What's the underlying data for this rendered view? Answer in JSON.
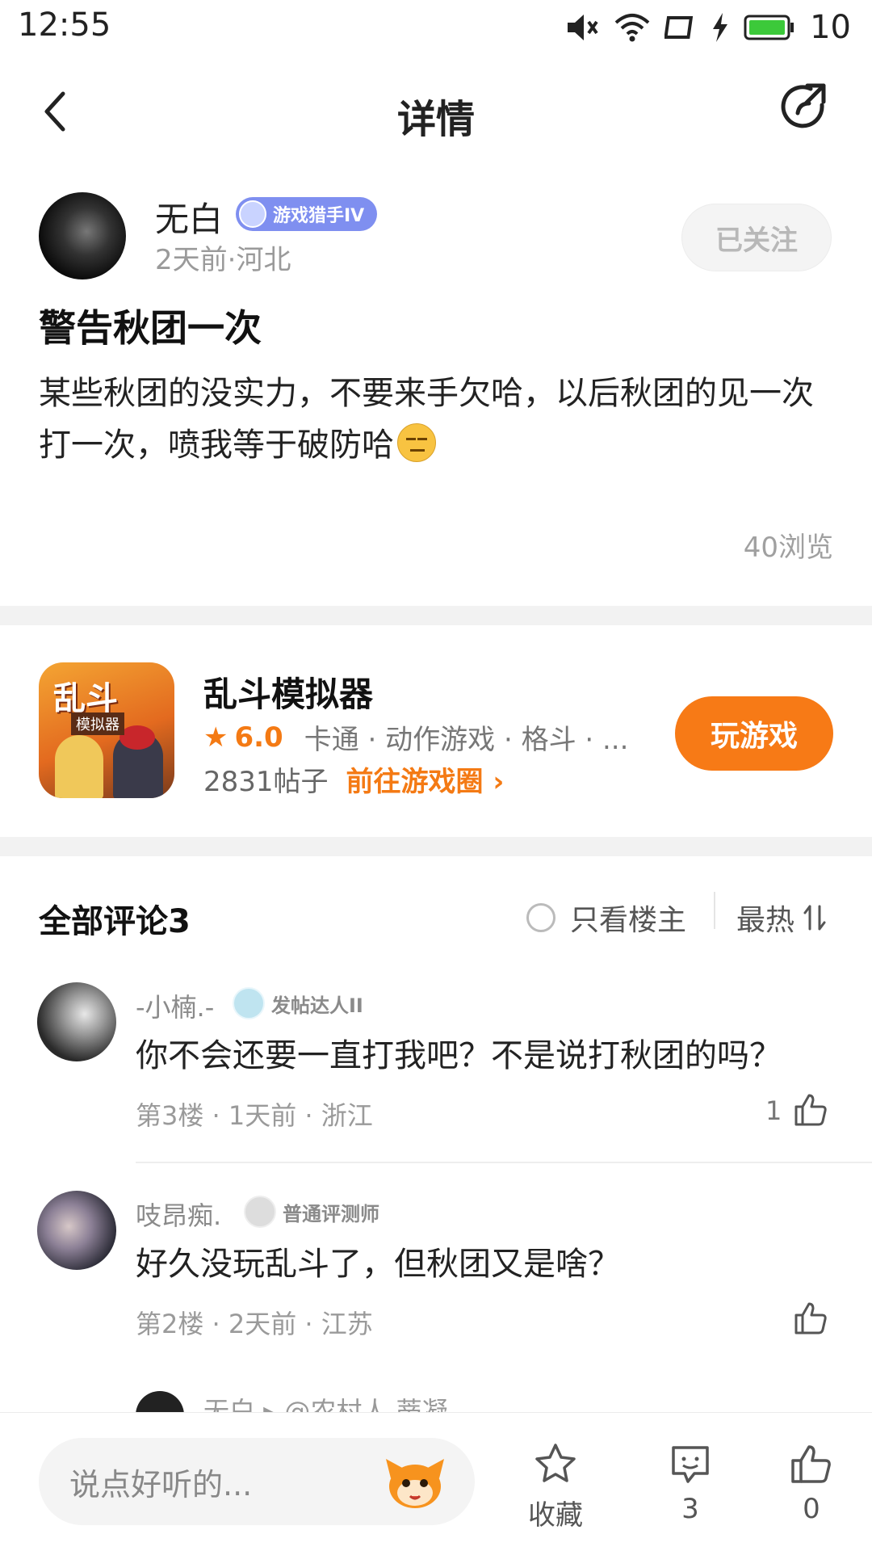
{
  "status_bar": {
    "time": "12:55",
    "battery": "10"
  },
  "header": {
    "title": "详情"
  },
  "author": {
    "name": "无白",
    "badge": "游戏猎手IV",
    "meta": "2天前·河北",
    "follow_label": "已关注"
  },
  "post": {
    "title": "警告秋团一次",
    "body": "某些秋团的没实力，不要来手欠哈，以后秋团的见一次打一次，喷我等于破防哈",
    "views": "40浏览"
  },
  "game": {
    "icon_title": "乱斗",
    "icon_sub": "模拟器",
    "name": "乱斗模拟器",
    "rating": "6.0",
    "tags": "卡通 · 动作游戏 · 格斗 · ...",
    "posts": "2831帖子",
    "goto_label": "前往游戏圈 ›",
    "play_label": "玩游戏"
  },
  "comments_header": {
    "title": "全部评论3",
    "only_op": "只看楼主",
    "sort": "最热"
  },
  "comments": [
    {
      "name": "-小楠.-",
      "badge": "发帖达人II",
      "text": "你不会还要一直打我吧？不是说打秋团的吗？",
      "meta": "第3楼 · 1天前 · 浙江",
      "likes": "1"
    },
    {
      "name": "吱昂痴.",
      "badge": "普通评测师",
      "text": "好久没玩乱斗了，但秋团又是啥？",
      "meta": "第2楼 · 2天前 · 江苏",
      "likes": ""
    }
  ],
  "peek_comment": "无白 ▸ @农村人 蒂凝",
  "bottom_bar": {
    "input_placeholder": "说点好听的...",
    "favorite_label": "收藏",
    "comment_count": "3",
    "like_count": "0"
  },
  "colors": {
    "accent_orange": "#f77a16",
    "badge_purple": "#7f8ff0"
  }
}
